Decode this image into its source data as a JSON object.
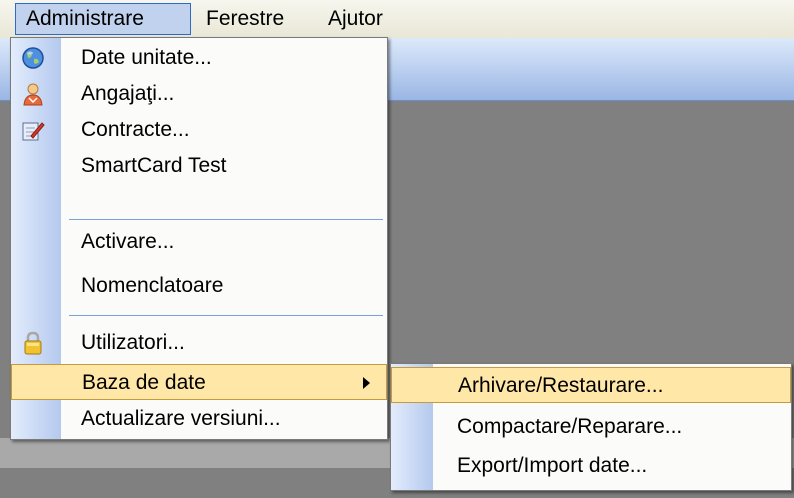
{
  "menubar": {
    "items": [
      {
        "label": "Administrare"
      },
      {
        "label": "Ferestre"
      },
      {
        "label": "Ajutor"
      }
    ]
  },
  "main_menu": {
    "items": [
      {
        "label": "Date unitate...",
        "icon": "globe-icon"
      },
      {
        "label": "Angajaţi...",
        "icon": "person-icon"
      },
      {
        "label": "Contracte...",
        "icon": "document-edit-icon"
      },
      {
        "label": "SmartCard Test"
      },
      {
        "label": "Activare..."
      },
      {
        "label": "Nomenclatoare"
      },
      {
        "label": "Utilizatori...",
        "icon": "lock-icon"
      },
      {
        "label": "Baza de date",
        "has_submenu": true,
        "highlighted": true
      },
      {
        "label": "Actualizare versiuni..."
      }
    ]
  },
  "sub_menu": {
    "items": [
      {
        "label": "Arhivare/Restaurare...",
        "highlighted": true
      },
      {
        "label": "Compactare/Reparare..."
      },
      {
        "label": "Export/Import date..."
      }
    ]
  },
  "colors": {
    "menu_highlight": "#ffe7a8",
    "menubar_active": "#c1d2ee",
    "gutter_blue": "#b4c9ee",
    "workspace": "#808080"
  }
}
